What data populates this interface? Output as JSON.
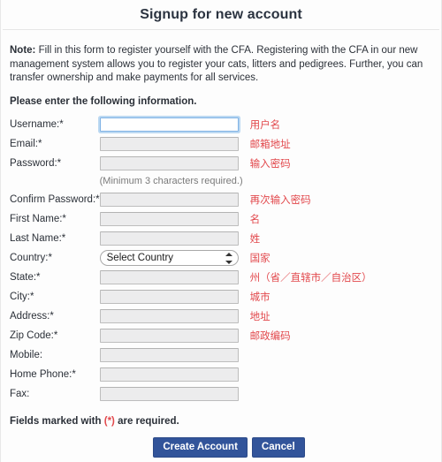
{
  "header": {
    "title": "Signup for new account"
  },
  "intro": {
    "note_label": "Note:",
    "note_text": " Fill in this form to register yourself with the CFA. Registering with the CFA in our new management system allows you to register your cats, litters and pedigrees. Further, you can transfer ownership and make payments for all services.",
    "please_enter": "Please enter the following information."
  },
  "form": {
    "fields": [
      {
        "label": "Username:*",
        "type": "text",
        "value": "",
        "focused": true,
        "annotation": "用户名"
      },
      {
        "label": "Email:*",
        "type": "text",
        "value": "",
        "focused": false,
        "annotation": "邮箱地址"
      },
      {
        "label": "Password:*",
        "type": "text",
        "value": "",
        "focused": false,
        "annotation": "输入密码"
      },
      {
        "label": "Confirm Password:*",
        "type": "text",
        "value": "",
        "focused": false,
        "annotation": "再次输入密码"
      },
      {
        "label": "First Name:*",
        "type": "text",
        "value": "",
        "focused": false,
        "annotation": "名"
      },
      {
        "label": "Last Name:*",
        "type": "text",
        "value": "",
        "focused": false,
        "annotation": "姓"
      },
      {
        "label": "Country:*",
        "type": "select",
        "value": "Select Country",
        "focused": false,
        "annotation": "国家"
      },
      {
        "label": "State:*",
        "type": "text",
        "value": "",
        "focused": false,
        "annotation": "州（省／直辖市／自治区）"
      },
      {
        "label": "City:*",
        "type": "text",
        "value": "",
        "focused": false,
        "annotation": "城市"
      },
      {
        "label": "Address:*",
        "type": "text",
        "value": "",
        "focused": false,
        "annotation": "地址"
      },
      {
        "label": "Zip Code:*",
        "type": "text",
        "value": "",
        "focused": false,
        "annotation": "邮政编码"
      },
      {
        "label": "Mobile:",
        "type": "text",
        "value": "",
        "focused": false,
        "annotation": ""
      },
      {
        "label": "Home Phone:*",
        "type": "text",
        "value": "",
        "focused": false,
        "annotation": ""
      },
      {
        "label": "Fax:",
        "type": "text",
        "value": "",
        "focused": false,
        "annotation": ""
      }
    ],
    "password_hint": "(Minimum 3 characters required.)",
    "select_placeholder": "Select Country"
  },
  "footer": {
    "required_prefix": "Fields marked with ",
    "required_star": "(*)",
    "required_suffix": " are required.",
    "create_button": "Create Account",
    "cancel_button": "Cancel"
  },
  "colors": {
    "accent_blue": "#32549a",
    "annotation_red": "#e2484c",
    "focus_ring": "#bcd9f2"
  }
}
